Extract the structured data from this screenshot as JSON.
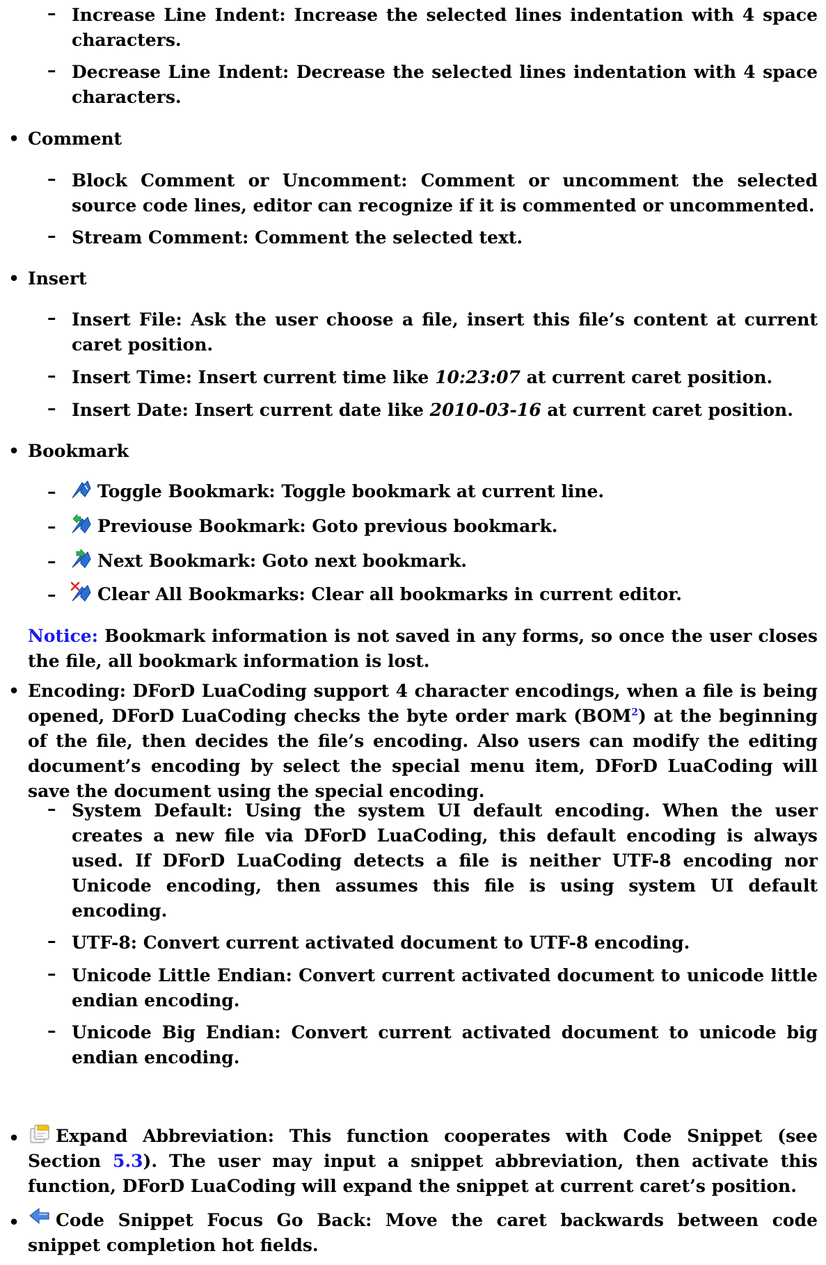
{
  "increase_indent": {
    "dash": "–",
    "text": "Increase Line Indent: Increase the selected lines indentation with 4 space characters."
  },
  "decrease_indent": {
    "dash": "–",
    "text": "Decrease Line Indent: Decrease the selected lines indentation with 4 space characters."
  },
  "comment": {
    "bullet": "•",
    "heading": "Comment",
    "block": "Block Comment or Uncomment: Comment or uncomment the selected source code lines, editor can recognize if it is commented or uncommented.",
    "stream": "Stream Comment: Comment the selected text."
  },
  "insert": {
    "bullet": "•",
    "heading": "Insert",
    "file": "Insert File: Ask the user choose a file, insert this file’s content at current caret position.",
    "time_prefix": "Insert Time: Insert current time like",
    "time_example": "10:23:07",
    "time_suffix": "at current caret position.",
    "date_prefix": "Insert Date: Insert current date like",
    "date_example": "2010-03-16",
    "date_suffix": "at current caret position."
  },
  "bookmark": {
    "bullet": "•",
    "heading": "Bookmark",
    "toggle": "Toggle Bookmark: Toggle bookmark at current line.",
    "previous": "Previouse Bookmark: Goto previous bookmark.",
    "next": "Next Bookmark: Goto next bookmark.",
    "clear": "Clear All Bookmarks: Clear all bookmarks in current editor.",
    "toggle_icon": "bookmark-toggle-icon",
    "previous_icon": "bookmark-previous-icon",
    "next_icon": "bookmark-next-icon",
    "clear_icon": "bookmark-clear-icon"
  },
  "notice": {
    "label": "Notice:",
    "text": "Bookmark information is not saved in any forms, so once the user closes the file, all bookmark information is lost."
  },
  "encoding": {
    "bullet": "•",
    "intro_a": "Encoding: DForD LuaCoding support 4 character encodings, when a file is being opened, DForD LuaCoding checks the byte order mark (BOM",
    "footnote": "2",
    "intro_b": ") at the beginning of the file, then decides the file’s encoding. Also users can modify the editing document’s encoding by select the special menu item, DForD LuaCoding will save the document using the special encoding.",
    "system_default": "System Default: Using the system UI default encoding. When the user creates a new file via DForD LuaCoding, this default encoding is always used. If DForD LuaCoding detects a file is neither UTF-8 encoding nor Unicode encoding, then assumes this file is using system UI default encoding.",
    "utf8": "UTF-8: Convert current activated document to UTF-8 encoding.",
    "unicode_le": "Unicode Little Endian: Convert current activated document to unicode little endian encoding.",
    "unicode_be": "Unicode Big Endian: Convert current activated document to unicode big endian encoding."
  },
  "expand": {
    "bullet": "•",
    "icon": "expand-abbreviation-icon",
    "text_a": "Expand Abbreviation: This function cooperates with Code Snippet (see Section",
    "section_ref": "5.3",
    "text_b": "). The user may input a snippet abbreviation, then activate this function, DForD LuaCoding will expand the snippet at current caret’s position."
  },
  "goback": {
    "bullet": "•",
    "icon": "go-back-arrow-icon",
    "text": "Code Snippet Focus Go Back: Move the caret backwards between code snippet completion hot fields."
  },
  "colors": {
    "link": "#1a1aee",
    "text": "#000000",
    "bookmark_blue": "#2a6fd6",
    "bookmark_green": "#2bb24c",
    "bookmark_red": "#e0262a"
  }
}
